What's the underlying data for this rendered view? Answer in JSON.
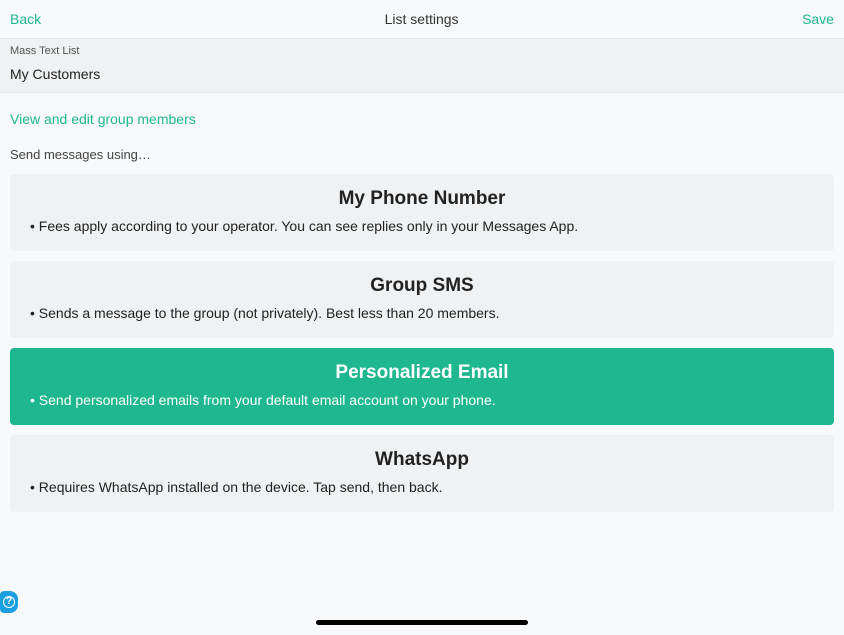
{
  "header": {
    "back": "Back",
    "title": "List settings",
    "save": "Save"
  },
  "listNameField": {
    "label": "Mass Text List",
    "value": "My Customers"
  },
  "groupLink": "View and edit group members",
  "sendLabel": "Send messages using…",
  "options": [
    {
      "title": "My Phone Number",
      "desc": "Fees apply according to your operator. You can see replies only in your Messages App.",
      "selected": false
    },
    {
      "title": "Group SMS",
      "desc": "Sends a message to the group (not privately). Best less than 20 members.",
      "selected": false
    },
    {
      "title": "Personalized Email",
      "desc": "Send personalized emails from your default email account on your phone.",
      "selected": true
    },
    {
      "title": "WhatsApp",
      "desc": "Requires WhatsApp installed on the device. Tap send, then back.",
      "selected": false
    }
  ],
  "helpBadge": "?"
}
